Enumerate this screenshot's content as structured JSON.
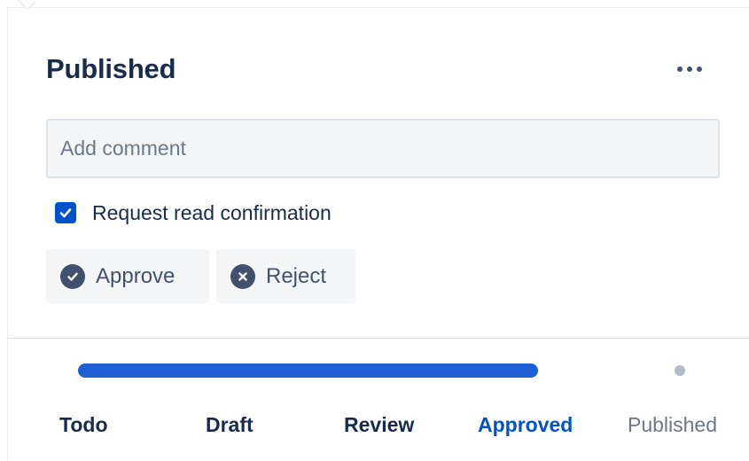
{
  "panel": {
    "title": "Published",
    "more_icon": "more-horizontal-icon"
  },
  "comment": {
    "placeholder": "Add comment",
    "value": ""
  },
  "read_confirmation": {
    "label": "Request read confirmation",
    "checked": true
  },
  "actions": {
    "approve": {
      "label": "Approve",
      "icon": "check-circle-icon"
    },
    "reject": {
      "label": "Reject",
      "icon": "cross-circle-icon"
    }
  },
  "workflow": {
    "steps": [
      {
        "label": "Todo",
        "state": "done"
      },
      {
        "label": "Draft",
        "state": "done"
      },
      {
        "label": "Review",
        "state": "done"
      },
      {
        "label": "Approved",
        "state": "current"
      },
      {
        "label": "Published",
        "state": "pending"
      }
    ],
    "progress_fraction": 0.75
  },
  "colors": {
    "accent": "#0052cc",
    "progress": "#1f5fd6",
    "text": "#172b4d",
    "muted": "#6b778c",
    "button_bg": "#f4f5f7"
  }
}
